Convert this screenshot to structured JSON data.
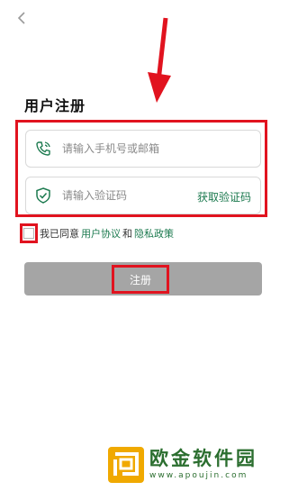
{
  "page": {
    "title": "用户注册"
  },
  "form": {
    "phone_placeholder": "请输入手机号或邮箱",
    "code_placeholder": "请输入验证码",
    "get_code_label": "获取验证码"
  },
  "agreement": {
    "prefix": "我已同意",
    "user_agreement": "用户协议",
    "conjunction": "和",
    "privacy_policy": "隐私政策",
    "checked": false
  },
  "register": {
    "label": "注册"
  },
  "watermark": {
    "title": "欧金软件园",
    "url": "www.apoujin.com"
  },
  "colors": {
    "accent_green": "#1c7a4f",
    "annotation_red": "#e1131f",
    "button_gray": "#a5a5a5",
    "logo_orange": "#f0a900"
  },
  "icons": {
    "back": "chevron-left-icon",
    "phone": "phone-icon",
    "shield": "shield-check-icon"
  }
}
